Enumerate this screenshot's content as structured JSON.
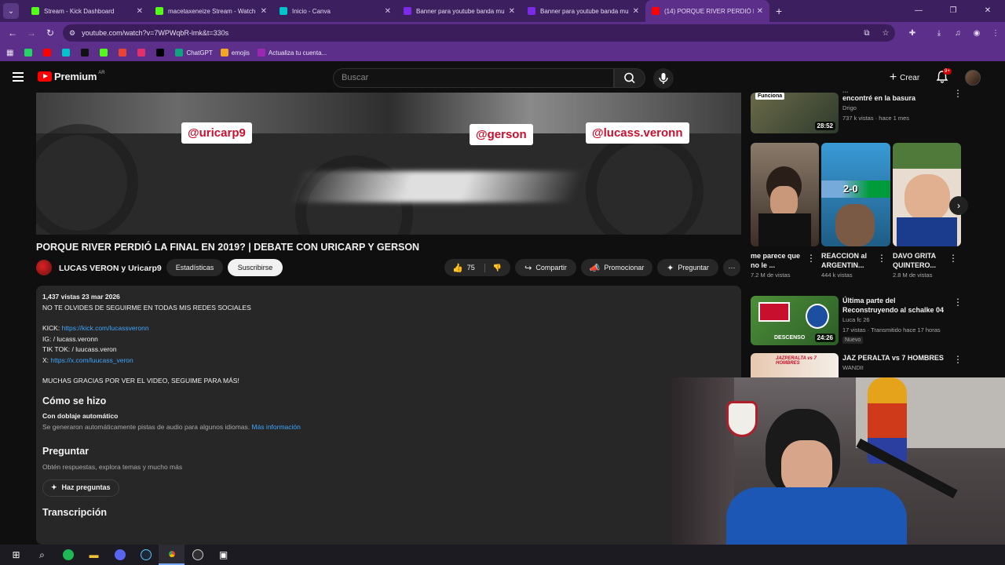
{
  "browser": {
    "tabs": [
      {
        "title": "Stream - Kick Dashboard",
        "color": "#53fc18",
        "active": false
      },
      {
        "title": "macetaxeneize Stream - Watch",
        "color": "#53fc18",
        "active": false
      },
      {
        "title": "Inicio - Canva",
        "color": "#00c4cc",
        "active": false
      },
      {
        "title": "Banner para youtube banda mu",
        "color": "#7d2ae8",
        "active": false
      },
      {
        "title": "Banner para youtube banda mu",
        "color": "#7d2ae8",
        "active": false
      },
      {
        "title": "(14) PORQUE RIVER PERDIÓ LA",
        "color": "#ff0000",
        "active": true
      }
    ],
    "url": "youtube.com/watch?v=7WPWqbR-lmk&t=330s",
    "bookmarks": [
      {
        "label": "",
        "color": "#25d366"
      },
      {
        "label": "",
        "color": "#ff0000"
      },
      {
        "label": "",
        "color": "#00c4cc"
      },
      {
        "label": "",
        "color": "#111111"
      },
      {
        "label": "",
        "color": "#53fc18"
      },
      {
        "label": "",
        "color": "#ea4335"
      },
      {
        "label": "",
        "color": "#e1306c"
      },
      {
        "label": "",
        "color": "#000000"
      },
      {
        "label": "ChatGPT",
        "color": "#10a37f"
      },
      {
        "label": "emojis",
        "color": "#f5a623"
      },
      {
        "label": "Actualiza tu cuenta...",
        "color": "#9c27b0"
      }
    ]
  },
  "youtube": {
    "logo_text": "Premium",
    "country_code": "AR",
    "search_placeholder": "Buscar",
    "create_label": "Crear",
    "notif_count": "9+"
  },
  "video": {
    "handles": [
      "@uricarp9",
      "@gerson",
      "@lucass.veronn"
    ],
    "title": "PORQUE RIVER PERDIÓ LA FINAL EN 2019? | DEBATE CON URICARP Y GERSON",
    "channel": "LUCAS VERON y Uricarp9",
    "stats_label": "Estadísticas",
    "subscribe_label": "Suscribirse",
    "likes": "75",
    "share_label": "Compartir",
    "promote_label": "Promocionar",
    "ask_label": "Preguntar"
  },
  "description": {
    "meta": "1,437 vistas  23 mar 2026",
    "line1": "NO TE OLVIDES DE SEGUIRME EN TODAS MIS REDES SOCIALES",
    "kick_label": "KICK: ",
    "kick_link": "https://kick.com/lucassveronn",
    "ig": "IG:   / lucass.veronn",
    "tiktok": "TIK TOK:   / luucass.veron",
    "x_label": "X: ",
    "x_link": "https://x.com/luucass_veron",
    "thanks": "MUCHAS GRACIAS POR VER EL VIDEO, SEGUIME PARA MÁS!",
    "how_title": "Cómo se hizo",
    "dub_title": "Con doblaje automático",
    "dub_text": "Se generaron automáticamente pistas de audio para algunos idiomas. ",
    "dub_link": "Más información",
    "ask_title": "Preguntar",
    "ask_text": "Obtén respuestas, explora temas y mucho más",
    "ask_button": "Haz preguntas",
    "transcript_title": "Transcripción"
  },
  "sidebar": {
    "top_video": {
      "thumb_label": "Funciona",
      "title": "encontré en la basura",
      "title_partial": "...",
      "channel": "Drigo",
      "meta": "737 k vistas · hace 1 mes",
      "duration": "28:52"
    },
    "shorts": [
      {
        "title": "me parece que no le ...",
        "views": "7.2 M de vistas"
      },
      {
        "title": "REACCION al ARGENTIN...",
        "views": "444 k vistas",
        "score": "2-0"
      },
      {
        "title": "DAVO GRITA QUINTERO...",
        "views": "2.8 M de vistas"
      }
    ],
    "videos": [
      {
        "title": "Última parte del Reconstruyendo al schalke 04",
        "channel": "Luca fc 26",
        "meta": "17 vistas · Transmitido hace 17 horas",
        "badge": "Nuevo",
        "duration": "24:26",
        "thumb_text": "DESCENSO"
      },
      {
        "title": "JAZ PERALTA vs 7 HOMBRES",
        "channel": "WANDII",
        "thumb_text": "JAZPERALTA vs 7 HOMBRES"
      }
    ]
  },
  "colors": {
    "chrome": "#5b2f8a",
    "chrome_dark": "#3b1f5e",
    "yt_bg": "#0f0f0f",
    "yt_red": "#ff0000",
    "link": "#3ea6ff"
  }
}
